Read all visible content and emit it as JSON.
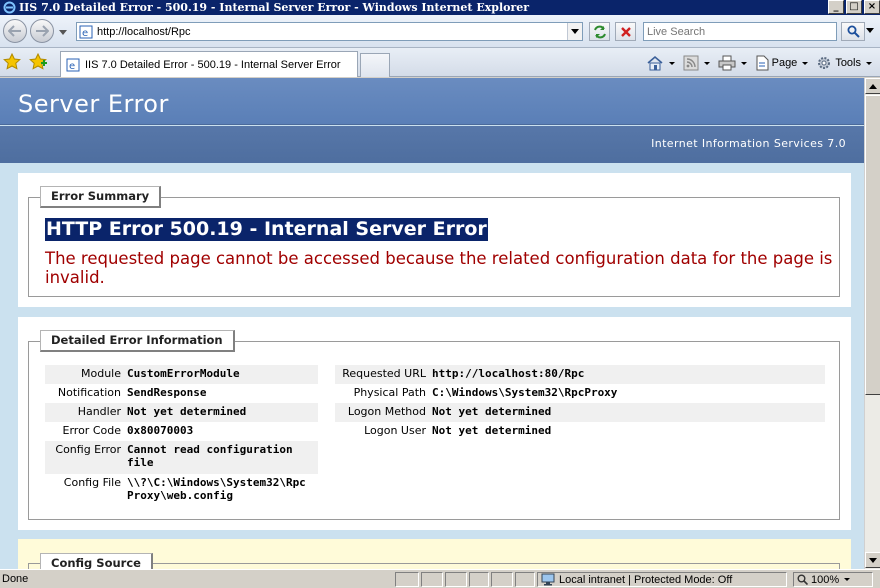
{
  "window": {
    "title": "IIS 7.0 Detailed Error - 500.19 - Internal Server Error - Windows Internet Explorer",
    "buttons": [
      "_",
      "□",
      "×"
    ]
  },
  "address_bar": {
    "url": "http://localhost/Rpc"
  },
  "search": {
    "placeholder": "Live Search"
  },
  "tab": {
    "label": "IIS 7.0 Detailed Error - 500.19 - Internal Server Error"
  },
  "command_bar": {
    "page_label": "Page",
    "tools_label": "Tools"
  },
  "page": {
    "header_title": "Server Error",
    "subheader": "Internet Information Services 7.0",
    "summary_legend": "Error Summary",
    "error_title": "HTTP Error 500.19 - Internal Server Error",
    "error_description": "The requested page cannot be accessed because the related configuration data for the page is invalid.",
    "details_legend": "Detailed Error Information",
    "details_left": [
      {
        "key": "Module",
        "value": "CustomErrorModule"
      },
      {
        "key": "Notification",
        "value": "SendResponse"
      },
      {
        "key": "Handler",
        "value": "Not yet determined"
      },
      {
        "key": "Error Code",
        "value": "0x80070003"
      },
      {
        "key": "Config Error",
        "value": "Cannot read configuration file"
      },
      {
        "key": "Config File",
        "value": "\\\\?\\C:\\Windows\\System32\\RpcProxy\\web.config"
      }
    ],
    "details_right": [
      {
        "key": "Requested URL",
        "value": "http://localhost:80/Rpc"
      },
      {
        "key": "Physical Path",
        "value": "C:\\Windows\\System32\\RpcProxy"
      },
      {
        "key": "Logon Method",
        "value": "Not yet determined"
      },
      {
        "key": "Logon User",
        "value": "Not yet determined"
      }
    ],
    "config_source_legend": "Config Source"
  },
  "status_bar": {
    "status": "Done",
    "zone": "Local intranet | Protected Mode: Off",
    "zoom": "100%"
  }
}
